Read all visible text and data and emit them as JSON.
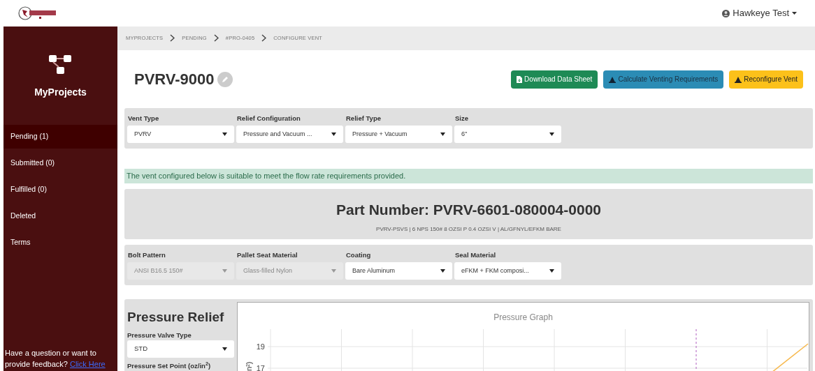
{
  "header": {
    "user": "Hawkeye Test"
  },
  "sidebar": {
    "title": "MyProjects",
    "items": [
      {
        "label": "Pending (1)",
        "selected": true
      },
      {
        "label": "Submitted (0)",
        "selected": false
      },
      {
        "label": "Fulfilled (0)",
        "selected": false
      },
      {
        "label": "Deleted",
        "selected": false
      },
      {
        "label": "Terms",
        "selected": false
      }
    ],
    "feedback": {
      "text": "Have a question or want to provide feedback?",
      "link": "Click Here"
    }
  },
  "breadcrumbs": [
    "MYPROJECTS",
    "PENDING",
    "#PRO-0405",
    "CONFIGURE VENT"
  ],
  "title": "PVRV-9000",
  "buttons": [
    {
      "label": "Download Data Sheet",
      "kind": "download",
      "color": "#1e8a55"
    },
    {
      "label": "Calculate Venting Requirements",
      "kind": "calculate",
      "color": "#2b8cb5"
    },
    {
      "label": "Reconfigure Vent",
      "kind": "reconfigure",
      "color": "#fcc11a"
    }
  ],
  "vent_fields": [
    {
      "label": "Vent Type",
      "value": "PVRV",
      "disabled": false
    },
    {
      "label": "Relief Configuration",
      "value": "Pressure and Vacuum ...",
      "disabled": false
    },
    {
      "label": "Relief Type",
      "value": "Pressure + Vacuum",
      "disabled": false
    },
    {
      "label": "Size",
      "value": "6\"",
      "disabled": false
    }
  ],
  "alert": "The vent configured below is suitable to meet the flow rate requirements provided.",
  "part_number": {
    "label": "Part Number:",
    "value": "PVRV-6601-080004-0000",
    "description": "PVRV-PSVS | 6 NPS 150# 8 OZSI P 0.4 OZSI V | AL/GFNYL/EFKM BARE"
  },
  "material_fields": [
    {
      "label": "Bolt Pattern",
      "value": "ANSI B16.5 150#",
      "disabled": true
    },
    {
      "label": "Pallet Seat Material",
      "value": "Glass-filled Nylon",
      "disabled": true
    },
    {
      "label": "Coating",
      "value": "Bare Aluminum",
      "disabled": false
    },
    {
      "label": "Seal Material",
      "value": "eFKM + FKM composi...",
      "disabled": false
    }
  ],
  "pressure_relief": {
    "title": "Pressure Relief",
    "fields": [
      {
        "label": "Pressure Valve Type",
        "value": "STD",
        "disabled": false
      },
      {
        "label": "Pressure Set Point (oz/in$^{2}$)"
      }
    ],
    "graph": {
      "title": "Pressure Graph",
      "ylabel": "n²)",
      "ticks": [
        "19",
        "17"
      ]
    }
  }
}
